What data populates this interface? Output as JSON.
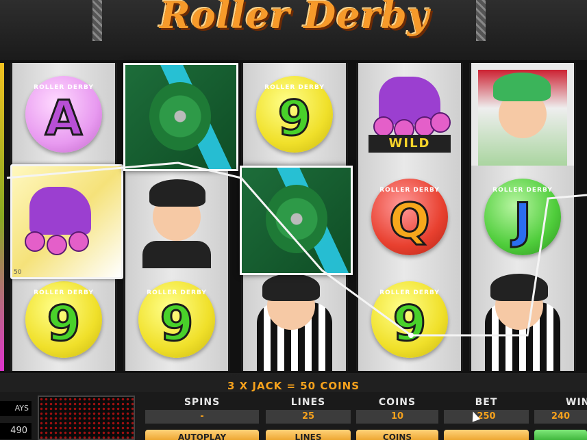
{
  "title": "Roller Derby",
  "win_message": "3 X JACK  =  50 COINS",
  "reels": [
    {
      "top": "A",
      "middle": "skate",
      "bottom": "9"
    },
    {
      "top": "wheel",
      "middle": "derby-girl",
      "bottom": "9"
    },
    {
      "top": "9",
      "middle": "wheel",
      "bottom": "referee"
    },
    {
      "top": "wild",
      "middle": "Q",
      "bottom": "9"
    },
    {
      "top": "derby-girl-green",
      "middle": "J",
      "bottom": "referee"
    }
  ],
  "coin_text": "ROLLER DERBY",
  "wild_text": "WILD",
  "small_badge": "50",
  "stats": {
    "spins": {
      "label": "SPINS",
      "value": "-"
    },
    "lines": {
      "label": "LINES",
      "value": "25"
    },
    "coins": {
      "label": "COINS",
      "value": "10"
    },
    "bet": {
      "label": "BET",
      "value": "250"
    },
    "win": {
      "label": "WIN",
      "value": "240"
    }
  },
  "left_panel": {
    "label": "AYS",
    "value": "490"
  },
  "buttons": {
    "autoplay": "AUTOPLAY",
    "lines": "LINES",
    "coins": "COINS"
  },
  "colors": {
    "accent": "#f7a21c",
    "frame": "#f4f4f4"
  }
}
